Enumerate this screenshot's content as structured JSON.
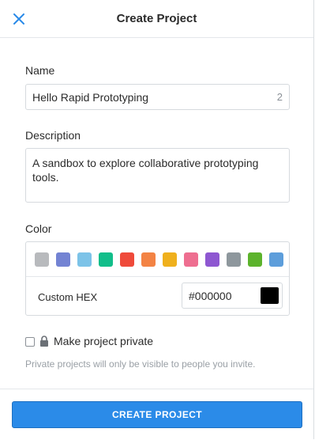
{
  "header": {
    "title": "Create Project",
    "close_icon": "close-icon"
  },
  "form": {
    "name": {
      "label": "Name",
      "value": "Hello Rapid Prototyping",
      "count": "2"
    },
    "description": {
      "label": "Description",
      "value": "A sandbox to explore collaborative prototyping tools."
    },
    "color": {
      "label": "Color",
      "swatches": [
        "#b8babd",
        "#7383d3",
        "#7cc3e8",
        "#12be8a",
        "#ef4a3a",
        "#f38344",
        "#efb01d",
        "#ee6e90",
        "#8e57d1",
        "#8e979d",
        "#5cb32c",
        "#5d9edb"
      ],
      "custom_hex_label": "Custom HEX",
      "custom_hex_value": "#000000",
      "preview_color": "#000000"
    },
    "private": {
      "label": "Make project private",
      "checked": false,
      "lock_icon": "lock-icon",
      "hint": "Private projects will only be visible to people you invite."
    }
  },
  "footer": {
    "create_label": "CREATE PROJECT"
  },
  "colors": {
    "accent": "#2b8be8"
  }
}
